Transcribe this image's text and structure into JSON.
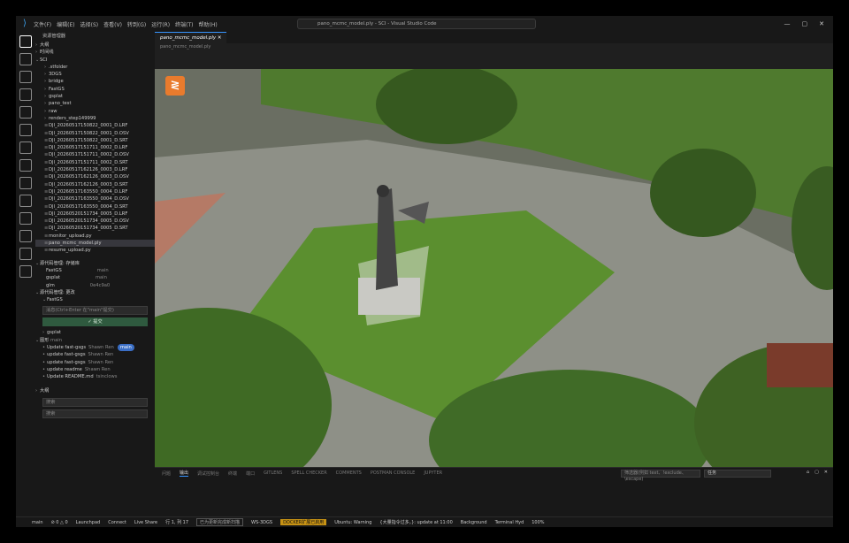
{
  "window": {
    "title": "pano_mcmc_model.ply - SCI - Visual Studio Code",
    "menus": [
      "文件(F)",
      "编辑(E)",
      "选择(S)",
      "查看(V)",
      "转到(G)",
      "运行(R)",
      "终端(T)",
      "帮助(H)"
    ],
    "controls": [
      "—",
      "▢",
      "✕"
    ]
  },
  "explorer": {
    "header": "资源管理器",
    "sections": [
      "大纲",
      "时间线"
    ],
    "root": "SCI",
    "items": [
      ".stfolder",
      "3DGS",
      "bridge",
      "FastGS",
      "gsplat",
      "pano_test",
      "raw",
      "renders_step149999",
      "DJI_20260517150822_0001_D.LRF",
      "DJI_20260517150822_0001_D.OSV",
      "DJI_20260517150822_0001_D.SRT",
      "DJI_20260517151711_0002_D.LRF",
      "DJI_20260517151711_0002_D.OSV",
      "DJI_20260517151711_0002_D.SRT",
      "DJI_20260517162126_0003_D.LRF",
      "DJI_20260517162126_0003_D.OSV",
      "DJI_20260517162126_0003_D.SRT",
      "DJI_20260517163550_0004_D.LRF",
      "DJI_20260517163550_0004_D.OSV",
      "DJI_20260517163550_0004_D.SRT",
      "DJI_20260520151734_0005_D.LRF",
      "DJI_20260520151734_0005_D.OSV",
      "DJI_20260520151734_0005_D.SRT",
      "monitor_upload.py",
      "pano_mcmc_model.ply",
      "resume_upload.py"
    ],
    "selected": "pano_mcmc_model.ply"
  },
  "scm": {
    "repos_header": "源代码管理: 存储库",
    "repos": [
      {
        "name": "FastGS",
        "branch": "main"
      },
      {
        "name": "gsplat",
        "branch": "main"
      },
      {
        "name": "glm",
        "branch": "0e4c9a0"
      }
    ],
    "changes_header": "源代码管理: 更改",
    "repo1": "FastGS",
    "placeholder": "消息(Ctrl+Enter 在\"main\"提交)",
    "commit": "✓ 提交",
    "repo2": "gsplat",
    "graph": "图形",
    "graph_ref": "main",
    "commits": [
      {
        "msg": "Update fast-gsgs",
        "author": "Shawn Ren",
        "badge": "main"
      },
      {
        "msg": "update fast-gsgs",
        "author": "Shawn Ren"
      },
      {
        "msg": "update fast-gsgs",
        "author": "Shawn Ren"
      },
      {
        "msg": "update readme",
        "author": "Shawn Ren"
      },
      {
        "msg": "Update README.md",
        "author": "tsinclows"
      }
    ]
  },
  "bottom_left": {
    "section": "大纲",
    "search1": "搜索",
    "search2": "搜索"
  },
  "tab": {
    "label": "pano_mcmc_model.ply",
    "close": "✕"
  },
  "breadcrumb": "pano_mcmc_model.ply",
  "panel": {
    "tabs": [
      "问题",
      "输出",
      "调试控制台",
      "终端",
      "端口",
      "GITLENS",
      "SPELL CHECKER",
      "COMMENTS",
      "POSTMAN CONSOLE",
      "JUPYTER"
    ],
    "active": "输出",
    "filter": "筛选器(例如 text、!exclude、\\escape)",
    "select": "任务"
  },
  "status": {
    "items": [
      "main",
      "⊘ 0 △ 0",
      "Launchpad",
      "Connect",
      "Live Share",
      "行 1, 列 17",
      "已为更新完成新扫描",
      "WS-3DGS",
      "DOCKER扩展已启用",
      "Ubuntu: Warning",
      "{大量指令过多，}: update at 11:00",
      "Background",
      "Terminal Hyd",
      "100%"
    ]
  },
  "colors": {
    "accent": "#3794ff",
    "logo": "#e97b2d",
    "grass": "#4d8a30"
  }
}
